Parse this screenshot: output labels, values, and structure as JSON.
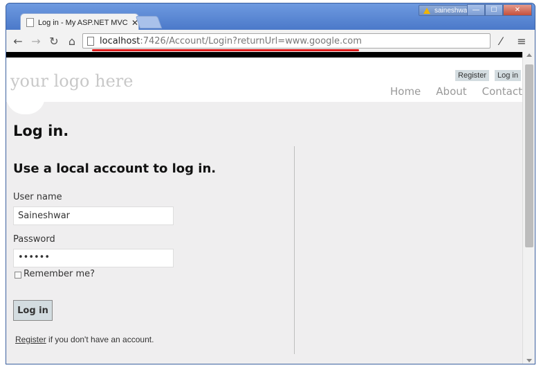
{
  "browser": {
    "tab_title": "Log in - My ASP.NET MVC Ap",
    "tab_close": "✕",
    "user_name": "saineshwar",
    "window_buttons": {
      "minimize": "—",
      "maximize": "☐",
      "close": "✕"
    },
    "url_host": "localhost",
    "url_rest": ":7426/Account/Login?returnUrl=www.google.com",
    "nav": {
      "back": "←",
      "forward": "→",
      "reload": "↻",
      "home": "⌂"
    },
    "tools": {
      "eyedropper": "⁄",
      "menu": "≡"
    },
    "accent_red": "#e01a1a"
  },
  "header": {
    "logo": "your logo here",
    "register": "Register",
    "login": "Log in",
    "nav": [
      "Home",
      "About",
      "Contact"
    ]
  },
  "page": {
    "title": "Log in.",
    "subtitle": "Use a local account to log in.",
    "username_label": "User name",
    "username_value": "Saineshwar",
    "password_label": "Password",
    "password_value": "••••••",
    "remember_label": "Remember me?",
    "submit_label": "Log in",
    "register_link": "Register",
    "register_suffix": " if you don't have an account."
  }
}
